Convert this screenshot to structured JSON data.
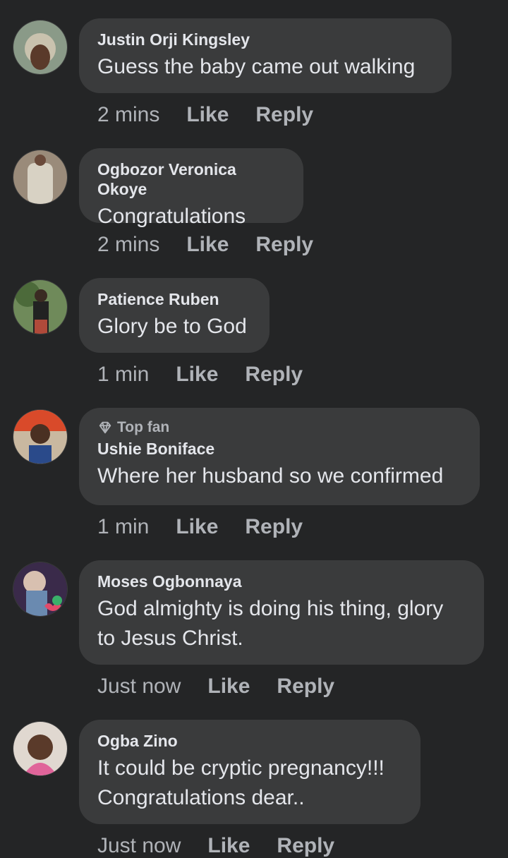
{
  "comments": [
    {
      "name": "Justin Orji Kingsley",
      "text": "Guess the baby came out walking",
      "time": "2 mins",
      "like": "Like",
      "reply": "Reply"
    },
    {
      "name": "Ogbozor Veronica Okoye",
      "text": "Congratulations",
      "time": "2 mins",
      "like": "Like",
      "reply": "Reply"
    },
    {
      "name": "Patience Ruben",
      "text": "Glory be to God",
      "time": "1 min",
      "like": "Like",
      "reply": "Reply"
    },
    {
      "badge": "Top fan",
      "name": "Ushie Boniface",
      "text": "Where her husband so we confirmed",
      "time": "1 min",
      "like": "Like",
      "reply": "Reply"
    },
    {
      "name": "Moses Ogbonnaya",
      "text_lines": [
        "God almighty is doing his thing, glory",
        "to Jesus Christ."
      ],
      "time": "Just now",
      "like": "Like",
      "reply": "Reply"
    },
    {
      "name": "Ogba Zino",
      "text_lines": [
        "It could be cryptic pregnancy!!!",
        "Congratulations dear.."
      ],
      "time": "Just now",
      "like": "Like",
      "reply": "Reply"
    }
  ],
  "colors": {
    "background": "#242526",
    "bubble": "#3a3b3c",
    "name": "#e4e6eb",
    "meta": "#b0b3b8"
  }
}
